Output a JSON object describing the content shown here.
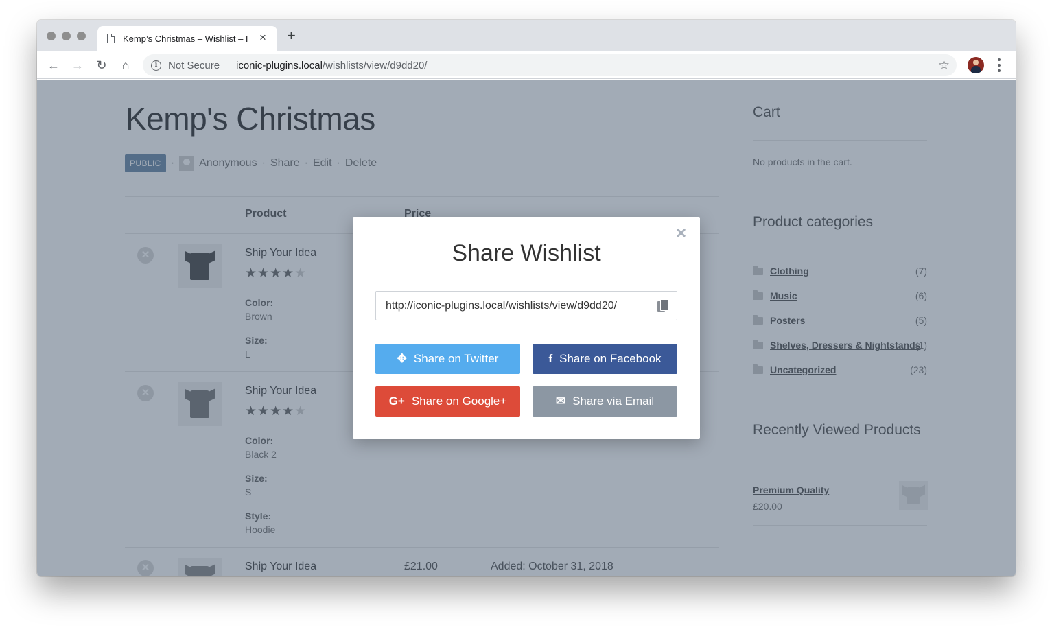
{
  "browser": {
    "tab_title": "Kemp’s Christmas – Wishlist – I",
    "tab_close": "×",
    "new_tab": "+",
    "security_label": "Not Secure",
    "url_host": "iconic-plugins.local",
    "url_path": "/wishlists/view/d9dd20/"
  },
  "page": {
    "title": "Kemp's Christmas",
    "badge": "PUBLIC",
    "author": "Anonymous",
    "actions": [
      "Share",
      "Edit",
      "Delete"
    ],
    "columns": [
      "Product",
      "Price"
    ],
    "items": [
      {
        "name": "Ship Your Idea",
        "color_label": "Color:",
        "color": "Brown",
        "size_label": "Size:",
        "size": "L"
      },
      {
        "name": "Ship Your Idea",
        "color_label": "Color:",
        "color": "Black 2",
        "size_label": "Size:",
        "size": "S",
        "style_label": "Style:",
        "style": "Hoodie"
      },
      {
        "name": "Ship Your Idea",
        "price": "£21.00",
        "added": "Added: October 31, 2018"
      }
    ]
  },
  "sidebar": {
    "cart_title": "Cart",
    "cart_empty": "No products in the cart.",
    "categories_title": "Product categories",
    "categories": [
      {
        "name": "Clothing",
        "count": "(7)"
      },
      {
        "name": "Music",
        "count": "(6)"
      },
      {
        "name": "Posters",
        "count": "(5)"
      },
      {
        "name": "Shelves, Dressers & Nightstands",
        "count": "(1)"
      },
      {
        "name": "Uncategorized",
        "count": "(23)"
      }
    ],
    "recent_title": "Recently Viewed Products",
    "recent_product": "Premium Quality",
    "recent_price": "£20.00"
  },
  "modal": {
    "title": "Share Wishlist",
    "close": "×",
    "share_url": "http://iconic-plugins.local/wishlists/view/d9dd20/",
    "buttons": {
      "twitter": "Share on Twitter",
      "facebook": "Share on Facebook",
      "google": "Share on Google+",
      "email": "Share via Email"
    },
    "colors": {
      "twitter": "#55acee",
      "facebook": "#3b5998",
      "google": "#dd4b39",
      "email": "#8c97a3"
    }
  }
}
